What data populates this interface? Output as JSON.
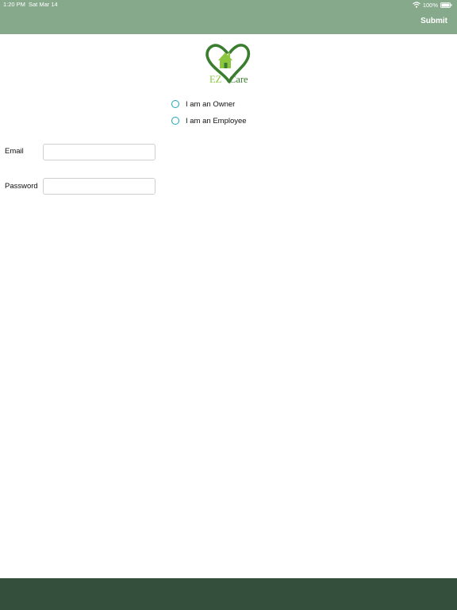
{
  "status_bar": {
    "time": "1:20 PM",
    "date": "Sat Mar 14",
    "battery": "100%"
  },
  "header": {
    "submit_label": "Submit"
  },
  "logo": {
    "text_ez": "EZ",
    "text_care": "Care"
  },
  "role_options": [
    {
      "label": "I am an Owner",
      "selected": false
    },
    {
      "label": "I am an Employee",
      "selected": false
    }
  ],
  "form": {
    "email_label": "Email",
    "email_value": "",
    "password_label": "Password",
    "password_value": ""
  },
  "colors": {
    "header": "#86a98c",
    "footer": "#344f3c",
    "radio": "#1aa7b8",
    "logo_dark_green": "#3a7d2e",
    "logo_light_green": "#8cc63f"
  }
}
